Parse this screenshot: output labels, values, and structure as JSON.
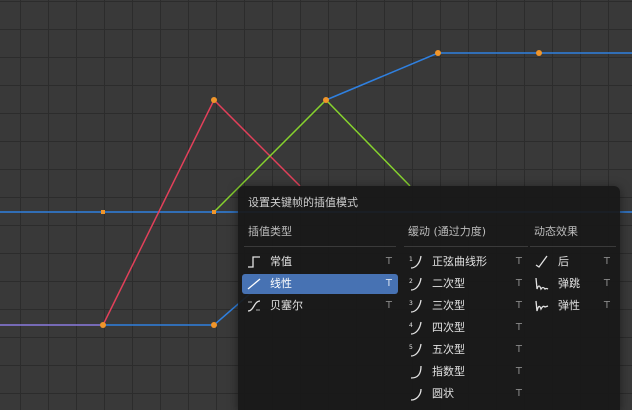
{
  "menu": {
    "title": "设置关键帧的插值模式",
    "columns": {
      "interpolation": "插值类型",
      "easing": "缓动 (通过力度)",
      "dynamic": "动态效果"
    },
    "interpolation_items": [
      {
        "label": "常值",
        "shortcut": "T",
        "icon": "constant-icon"
      },
      {
        "label": "线性",
        "shortcut": "T",
        "icon": "linear-icon",
        "selected": true
      },
      {
        "label": "贝塞尔",
        "shortcut": "T",
        "icon": "bezier-icon"
      }
    ],
    "easing_items": [
      {
        "label": "正弦曲线形",
        "shortcut": "T",
        "icon": "sine-icon",
        "degree": "1"
      },
      {
        "label": "二次型",
        "shortcut": "T",
        "icon": "quad-icon",
        "degree": "2"
      },
      {
        "label": "三次型",
        "shortcut": "T",
        "icon": "cubic-icon",
        "degree": "3"
      },
      {
        "label": "四次型",
        "shortcut": "T",
        "icon": "quart-icon",
        "degree": "4"
      },
      {
        "label": "五次型",
        "shortcut": "T",
        "icon": "quint-icon",
        "degree": "5"
      },
      {
        "label": "指数型",
        "shortcut": "T",
        "icon": "expo-icon"
      },
      {
        "label": "圆状",
        "shortcut": "T",
        "icon": "circ-icon"
      }
    ],
    "dynamic_items": [
      {
        "label": "后",
        "shortcut": "T",
        "icon": "back-icon"
      },
      {
        "label": "弹跳",
        "shortcut": "T",
        "icon": "bounce-icon"
      },
      {
        "label": "弹性",
        "shortcut": "T",
        "icon": "elastic-icon"
      }
    ]
  },
  "colors": {
    "background": "#393939",
    "grid": "#2c2c2c",
    "curve_red": "#e2405a",
    "curve_green": "#86d22e",
    "curve_blue": "#2f80e0",
    "curve_purple": "#8a7be0",
    "keyframe": "#f0952a",
    "selection": "#4772b3"
  }
}
